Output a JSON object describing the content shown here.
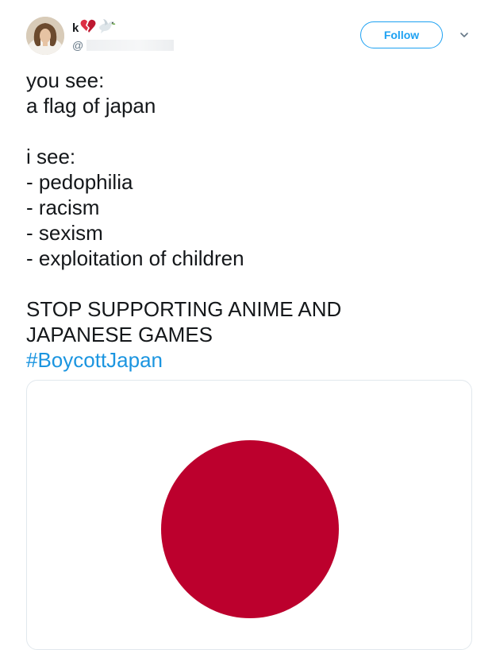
{
  "author": {
    "name": "k",
    "name_emojis": [
      "broken-heart-icon",
      "dove-icon"
    ],
    "handle_prefix": "@"
  },
  "actions": {
    "follow_label": "Follow"
  },
  "tweet": {
    "lines": [
      "you see:",
      "a flag of japan",
      "",
      "i see:",
      "- pedophilia",
      "- racism",
      "- sexism",
      "- exploitation of children",
      "",
      "STOP SUPPORTING ANIME AND",
      "JAPANESE GAMES"
    ],
    "hashtag": "#BoycottJapan"
  },
  "media": {
    "description_icon": "japan-flag-image",
    "flag_color": "#bc002d"
  },
  "colors": {
    "accent": "#1da1f2",
    "hashtag": "#1b95e0",
    "text": "#14171a",
    "muted": "#657786"
  }
}
